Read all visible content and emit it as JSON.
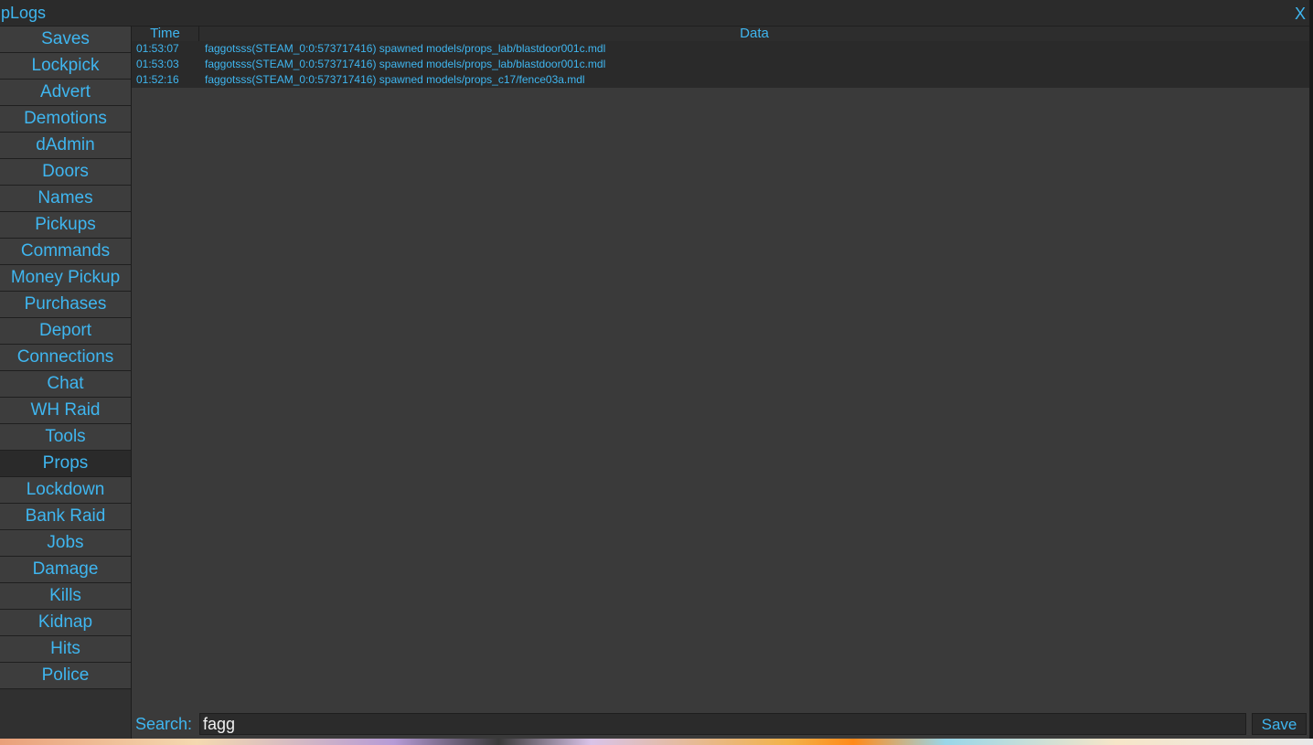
{
  "window": {
    "title": "pLogs",
    "close_label": "X"
  },
  "sidebar": {
    "items": [
      {
        "label": "Saves"
      },
      {
        "label": "Lockpick"
      },
      {
        "label": "Advert"
      },
      {
        "label": "Demotions"
      },
      {
        "label": "dAdmin"
      },
      {
        "label": "Doors"
      },
      {
        "label": "Names"
      },
      {
        "label": "Pickups"
      },
      {
        "label": "Commands"
      },
      {
        "label": "Money Pickup"
      },
      {
        "label": "Purchases"
      },
      {
        "label": "Deport"
      },
      {
        "label": "Connections"
      },
      {
        "label": "Chat"
      },
      {
        "label": "WH Raid"
      },
      {
        "label": "Tools"
      },
      {
        "label": "Props",
        "active": true
      },
      {
        "label": "Lockdown"
      },
      {
        "label": "Bank Raid"
      },
      {
        "label": "Jobs"
      },
      {
        "label": "Damage"
      },
      {
        "label": "Kills"
      },
      {
        "label": "Kidnap"
      },
      {
        "label": "Hits"
      },
      {
        "label": "Police"
      }
    ]
  },
  "table": {
    "columns": {
      "time": "Time",
      "data": "Data"
    },
    "rows": [
      {
        "time": "01:53:07",
        "data": "faggotsss(STEAM_0:0:573717416) spawned models/props_lab/blastdoor001c.mdl"
      },
      {
        "time": "01:53:03",
        "data": "faggotsss(STEAM_0:0:573717416) spawned models/props_lab/blastdoor001c.mdl"
      },
      {
        "time": "01:52:16",
        "data": "faggotsss(STEAM_0:0:573717416) spawned models/props_c17/fence03a.mdl"
      }
    ]
  },
  "search": {
    "label": "Search:",
    "value": "fagg",
    "save_label": "Save"
  },
  "colors": {
    "accent": "#3fb6f0",
    "panel": "#3a3a3a",
    "row": "#2a2a2a"
  }
}
